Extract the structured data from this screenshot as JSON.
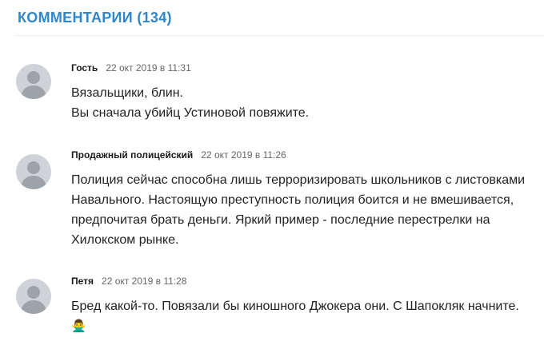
{
  "section": {
    "title": "КОММЕНТАРИИ (134)"
  },
  "comments": [
    {
      "author": "Гость",
      "date": "22 окт 2019 в 11:31",
      "lines": [
        "Вязальщики, блин.",
        "Вы сначала убийц Устиновой повяжите."
      ]
    },
    {
      "author": "Продажный полицейский",
      "date": "22 окт 2019 в 11:26",
      "lines": [
        "Полиция сейчас способна лишь терроризировать школьников с листовками Навального. Настоящую преступность полиция боится и не вмешивается, предпочитая брать деньги. Яркий пример - последние перестрелки на Хилокском рынке."
      ]
    },
    {
      "author": "Петя",
      "date": "22 окт 2019 в 11:28",
      "lines": [
        "Бред какой-то. Повязали бы киношного Джокера они. С Шапокляк начните."
      ],
      "emoji": "🙅‍♂️"
    }
  ],
  "icons": {
    "avatar": "default-user-avatar-icon"
  },
  "colors": {
    "accent": "#2f86c9",
    "avatar_bg": "#cfd2d6",
    "avatar_fg": "#9ea3a8"
  }
}
